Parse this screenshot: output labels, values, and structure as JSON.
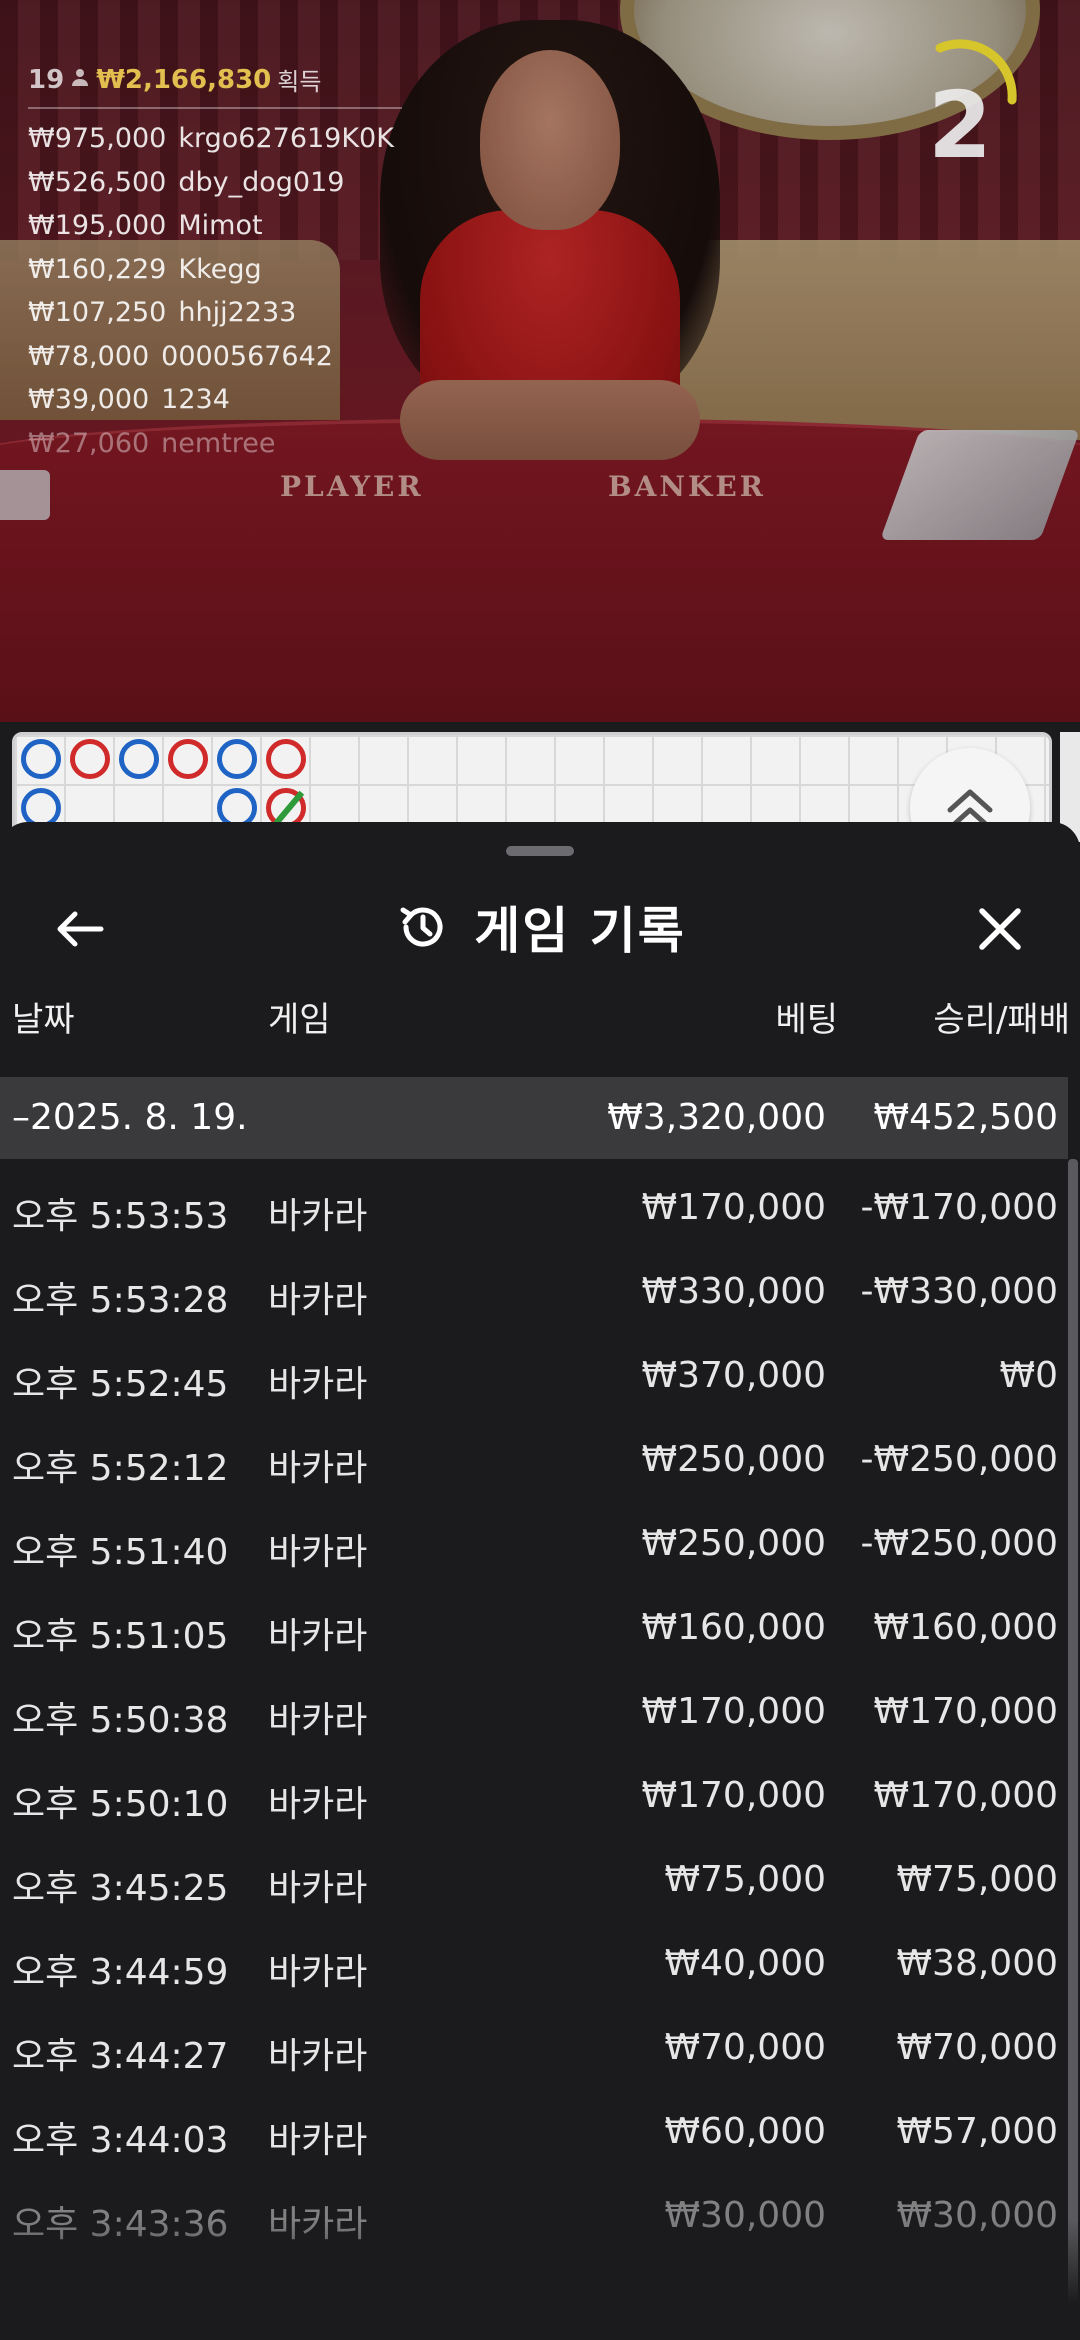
{
  "live": {
    "winners_header": {
      "count": "19",
      "amount": "₩2,166,830",
      "label": "획득"
    },
    "winners": [
      {
        "amount": "₩975,000",
        "name": "krgo627619K0K"
      },
      {
        "amount": "₩526,500",
        "name": "dby_dog019"
      },
      {
        "amount": "₩195,000",
        "name": "Mimot"
      },
      {
        "amount": "₩160,229",
        "name": "Kkegg"
      },
      {
        "amount": "₩107,250",
        "name": "hhjj2233"
      },
      {
        "amount": "₩78,000",
        "name": "0000567642"
      },
      {
        "amount": "₩39,000",
        "name": "1234"
      },
      {
        "amount": "₩27,060",
        "name": "nemtree"
      }
    ],
    "countdown": "2",
    "table_labels": {
      "player": "PLAYER",
      "banker": "BANKER"
    },
    "road": {
      "beads": [
        {
          "col": 0,
          "row": 0,
          "color": "blue"
        },
        {
          "col": 1,
          "row": 0,
          "color": "red"
        },
        {
          "col": 2,
          "row": 0,
          "color": "blue"
        },
        {
          "col": 3,
          "row": 0,
          "color": "red"
        },
        {
          "col": 4,
          "row": 0,
          "color": "blue"
        },
        {
          "col": 5,
          "row": 0,
          "color": "red"
        },
        {
          "col": 0,
          "row": 1,
          "color": "blue"
        },
        {
          "col": 4,
          "row": 1,
          "color": "blue"
        },
        {
          "col": 5,
          "row": 1,
          "color": "red",
          "tie": true
        }
      ]
    }
  },
  "sheet": {
    "title": "게임 기록",
    "icons": {
      "back": "arrow-left-icon",
      "history": "history-icon",
      "close": "close-icon",
      "scroll_up": "chevron-double-up-icon"
    },
    "columns": {
      "date": "날짜",
      "game": "게임",
      "bet": "베팅",
      "winloss": "승리/패배"
    },
    "summary": {
      "date": "–2025. 8. 19.",
      "bet": "₩3,320,000",
      "winloss": "₩452,500"
    },
    "rows": [
      {
        "time": "오후 5:53:53",
        "game": "바카라",
        "bet": "₩170,000",
        "winloss": "-₩170,000"
      },
      {
        "time": "오후 5:53:28",
        "game": "바카라",
        "bet": "₩330,000",
        "winloss": "-₩330,000"
      },
      {
        "time": "오후 5:52:45",
        "game": "바카라",
        "bet": "₩370,000",
        "winloss": "₩0"
      },
      {
        "time": "오후 5:52:12",
        "game": "바카라",
        "bet": "₩250,000",
        "winloss": "-₩250,000"
      },
      {
        "time": "오후 5:51:40",
        "game": "바카라",
        "bet": "₩250,000",
        "winloss": "-₩250,000"
      },
      {
        "time": "오후 5:51:05",
        "game": "바카라",
        "bet": "₩160,000",
        "winloss": "₩160,000"
      },
      {
        "time": "오후 5:50:38",
        "game": "바카라",
        "bet": "₩170,000",
        "winloss": "₩170,000"
      },
      {
        "time": "오후 5:50:10",
        "game": "바카라",
        "bet": "₩170,000",
        "winloss": "₩170,000"
      },
      {
        "time": "오후 3:45:25",
        "game": "바카라",
        "bet": "₩75,000",
        "winloss": "₩75,000"
      },
      {
        "time": "오후 3:44:59",
        "game": "바카라",
        "bet": "₩40,000",
        "winloss": "₩38,000"
      },
      {
        "time": "오후 3:44:27",
        "game": "바카라",
        "bet": "₩70,000",
        "winloss": "₩70,000"
      },
      {
        "time": "오후 3:44:03",
        "game": "바카라",
        "bet": "₩60,000",
        "winloss": "₩57,000"
      },
      {
        "time": "오후 3:43:36",
        "game": "바카라",
        "bet": "₩30,000",
        "winloss": "₩30,000"
      }
    ]
  },
  "colors": {
    "sheet_bg": "#1b1b1d",
    "summary_bg": "#3a3a3d",
    "text": "#e6e6e6",
    "winner_amount_gold": "#e2bf4e",
    "road_blue": "#1f63c4",
    "road_red": "#d02a2a",
    "felt_red": "#7c1722"
  }
}
